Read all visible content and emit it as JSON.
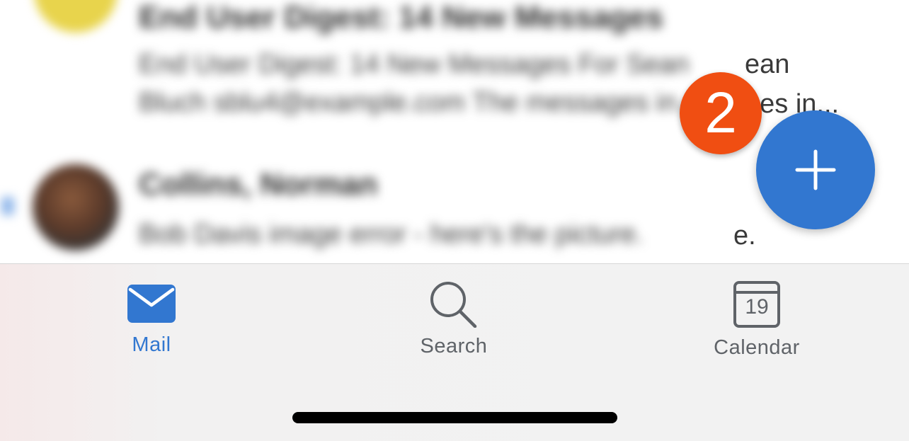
{
  "email_list": {
    "rows": [
      {
        "sender": "End User Digest: 14 New Messages",
        "preview_line1": "End User Digest: 14 New Messages For Sean",
        "preview_line2": "Bluch sblu4@example.com The messages in..."
      },
      {
        "sender": "Collins, Norman",
        "preview_line1": "Bob Davis image error - here's the picture."
      }
    ],
    "visible_fragments": {
      "row1_line1_end": "ean",
      "row1_line2_end": "ges in...",
      "row2_line1_end": "e."
    }
  },
  "compose_button": {
    "icon": "plus-icon",
    "color": "#3277d0"
  },
  "callout_badge": {
    "number": "2",
    "color": "#f04e12"
  },
  "tab_bar": {
    "tabs": [
      {
        "label": "Mail",
        "icon": "mail-icon",
        "active": true
      },
      {
        "label": "Search",
        "icon": "search-icon",
        "active": false
      },
      {
        "label": "Calendar",
        "icon": "calendar-icon",
        "day": "19",
        "active": false
      }
    ],
    "active_color": "#3277d0",
    "inactive_color": "#5f6368"
  }
}
